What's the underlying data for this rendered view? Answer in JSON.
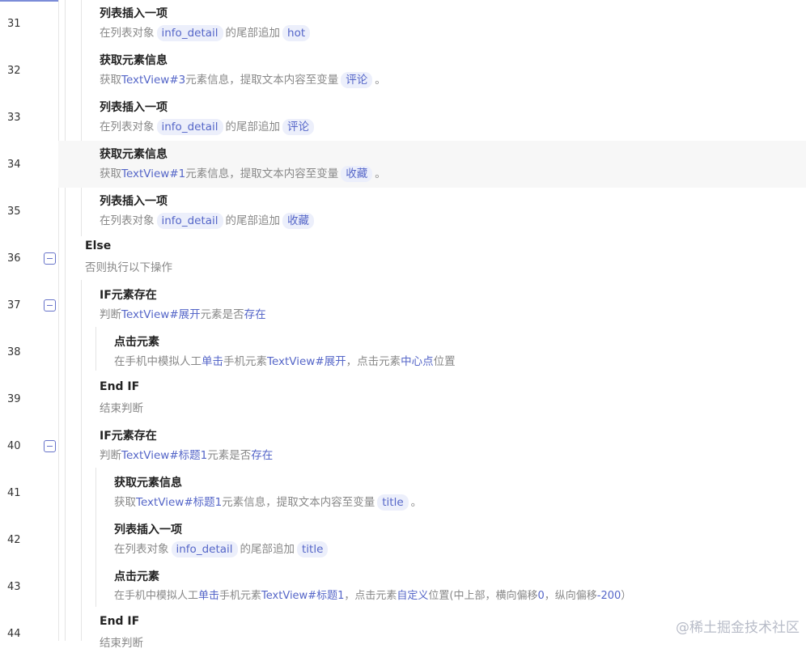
{
  "watermark": "@稀土掘金技术社区",
  "rows": [
    {
      "n": "31",
      "title": "列表插入一项",
      "d": [
        "在列表对象",
        "info_detail",
        "的尾部追加",
        "hot"
      ]
    },
    {
      "n": "32",
      "title": "获取元素信息",
      "d": [
        "获取",
        "TextView#3",
        "元素信息，提取文本内容至变量",
        "评论",
        "。"
      ]
    },
    {
      "n": "33",
      "title": "列表插入一项",
      "d": [
        "在列表对象",
        "info_detail",
        "的尾部追加",
        "评论"
      ]
    },
    {
      "n": "34",
      "title": "获取元素信息",
      "d": [
        "获取",
        "TextView#1",
        "元素信息，提取文本内容至变量",
        "收藏",
        "。"
      ]
    },
    {
      "n": "35",
      "title": "列表插入一项",
      "d": [
        "在列表对象",
        "info_detail",
        "的尾部追加",
        "收藏"
      ]
    },
    {
      "n": "36",
      "title": "Else",
      "d": [
        "否则执行以下操作"
      ]
    },
    {
      "n": "37",
      "title": "IF元素存在",
      "d": [
        "判断",
        "TextView#展开",
        "元素是否",
        "存在"
      ]
    },
    {
      "n": "38",
      "title": "点击元素",
      "d": [
        "在手机中模拟人工",
        "单击",
        "手机元素",
        "TextView#展开",
        "，点击元素",
        "中心点",
        "位置"
      ]
    },
    {
      "n": "39",
      "title": "End IF",
      "d": [
        "结束判断"
      ]
    },
    {
      "n": "40",
      "title": "IF元素存在",
      "d": [
        "判断",
        "TextView#标题1",
        "元素是否",
        "存在"
      ]
    },
    {
      "n": "41",
      "title": "获取元素信息",
      "d": [
        "获取",
        "TextView#标题1",
        "元素信息，提取文本内容至变量",
        "title",
        "。"
      ]
    },
    {
      "n": "42",
      "title": "列表插入一项",
      "d": [
        "在列表对象",
        "info_detail",
        "的尾部追加",
        "title"
      ]
    },
    {
      "n": "43",
      "title": "点击元素",
      "d": [
        "在手机中模拟人工",
        "单击",
        "手机元素",
        "TextView#标题1",
        "，点击元素",
        "自定义",
        "位置(中上部，横向偏移",
        "0",
        "，纵向偏移",
        "-200",
        "）"
      ]
    },
    {
      "n": "44",
      "title": "End IF",
      "d": [
        "结束判断"
      ]
    }
  ]
}
